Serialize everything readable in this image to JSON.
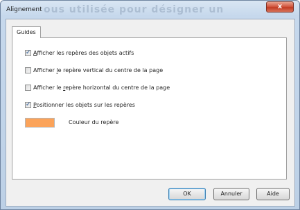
{
  "window": {
    "title": "Alignement",
    "ghost_text": "ous utilisée pour désigner un",
    "close_label": "x"
  },
  "tabs": [
    {
      "label": "Guides"
    }
  ],
  "options": [
    {
      "label_underlined": "A",
      "label_rest": "fficher les repères des objets actifs",
      "checked": true
    },
    {
      "label_pre": "Afficher ",
      "label_underlined": "l",
      "label_rest": "e repère vertical du centre de la page",
      "checked": false
    },
    {
      "label_pre": "Afficher le ",
      "label_underlined": "r",
      "label_rest": "epère horizontal du centre de la page",
      "checked": false
    },
    {
      "label_underlined": "P",
      "label_rest": "ositionner les objets sur les repères",
      "checked": true
    }
  ],
  "check_mark": "✓",
  "color": {
    "label": "Couleur du repère",
    "value": "#fba35a"
  },
  "buttons": {
    "ok": "OK",
    "cancel": "Annuler",
    "help": "Aide"
  }
}
